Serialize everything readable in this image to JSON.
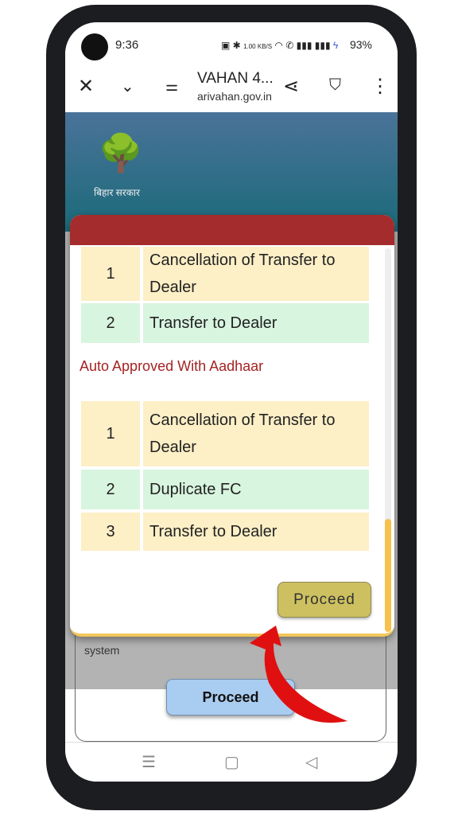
{
  "status_bar": {
    "time": "9:36",
    "net_speed": "1.00 KB/S",
    "battery": "93%"
  },
  "toolbar": {
    "title": "VAHAN 4...",
    "url": "arivahan.gov.in"
  },
  "banner": {
    "logo_text": "बिहार सरकार"
  },
  "modal": {
    "table1": [
      {
        "no": "1",
        "service": "Cancellation of Transfer to Dealer"
      },
      {
        "no": "2",
        "service": "Transfer to Dealer"
      }
    ],
    "section_heading": "Auto Approved With Aadhaar",
    "table2": [
      {
        "no": "1",
        "service": "Cancellation of Transfer to Dealer"
      },
      {
        "no": "2",
        "service": "Duplicate FC"
      },
      {
        "no": "3",
        "service": "Transfer to Dealer"
      }
    ],
    "proceed_label": "Proceed"
  },
  "background_page": {
    "text": "system",
    "proceed_label": "Proceed"
  },
  "colors": {
    "modal_header": "#a52c2c",
    "row_yellow": "#fdefc6",
    "row_green": "#d8f5df",
    "heading_red": "#a52323",
    "arrow": "#e01010"
  }
}
